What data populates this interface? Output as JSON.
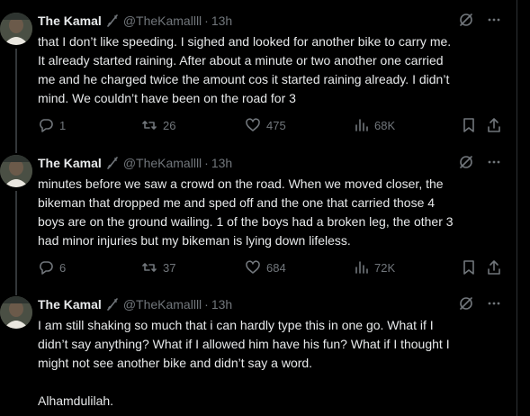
{
  "tweets": [
    {
      "name": "The Kamal",
      "handle": "@TheKamallll",
      "separator": "·",
      "time": "13h",
      "text": "that I don’t like speeding. I sighed and looked for another bike to carry me.\nIt already started raining. After about a minute or two another one carried\nme and he charged twice the amount cos it started raining already. I didn’t\nmind. We couldn’t have been on the road for 3",
      "replies": "1",
      "retweets": "26",
      "likes": "475",
      "views": "68K"
    },
    {
      "name": "The Kamal",
      "handle": "@TheKamallll",
      "separator": "·",
      "time": "13h",
      "text": "minutes before we saw a crowd on the road. When we moved closer, the\nbikeman that dropped me and sped off and the one that carried those 4\nboys are on the ground wailing. 1 of the boys had a broken leg, the other 3\nhad minor injuries but my bikeman is lying down lifeless.",
      "replies": "6",
      "retweets": "37",
      "likes": "684",
      "views": "72K"
    },
    {
      "name": "The Kamal",
      "handle": "@TheKamallll",
      "separator": "·",
      "time": "13h",
      "text": "I am still shaking so much that i can hardly type this in one go. What if I\ndidn’t say anything? What if I allowed him have his fun? What if I thought I\nmight not see another bike and didn’t say a word.\n\nAlhamdulilah."
    }
  ],
  "icons": {
    "badge": "quill-pen-icon",
    "grok": "grok-icon",
    "more": "more-dots-icon",
    "reply": "reply-icon",
    "retweet": "retweet-icon",
    "like": "heart-icon",
    "views": "views-icon",
    "bookmark": "bookmark-icon",
    "share": "share-icon"
  },
  "colors": {
    "background": "#000000",
    "text": "#e7e9ea",
    "muted": "#71767b",
    "thread_line": "#333639"
  }
}
